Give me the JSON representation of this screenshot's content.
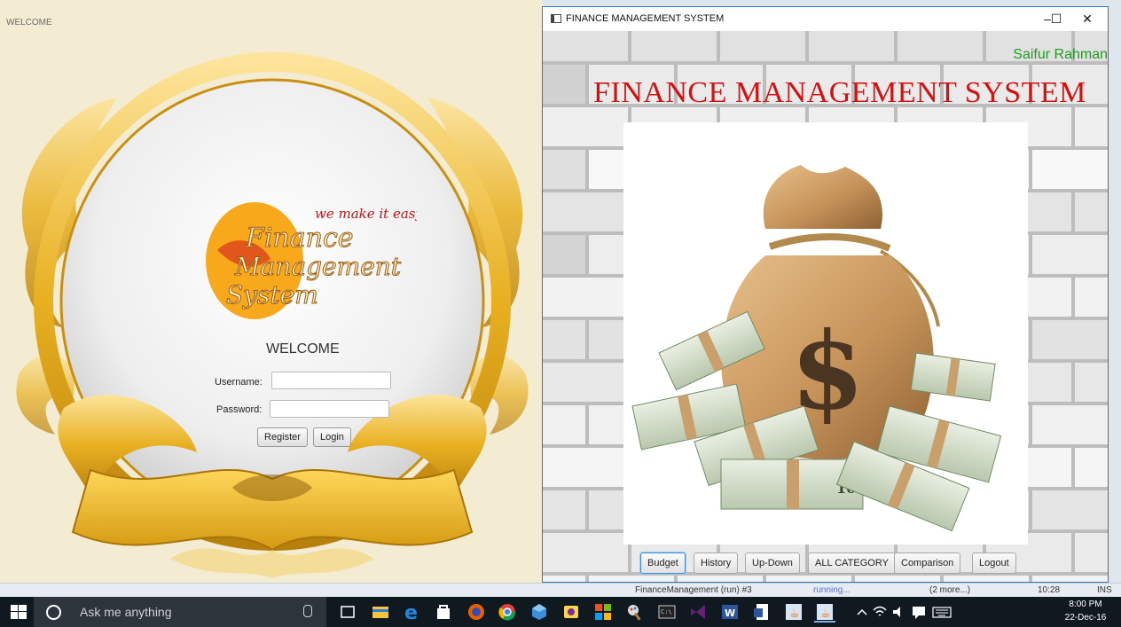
{
  "login": {
    "window_title": "WELCOME",
    "logo": {
      "tagline": "we make it easy",
      "line1": "Finance",
      "line2": "Management",
      "line3": "System"
    },
    "heading": "WELCOME",
    "username_label": "Username:",
    "username_value": "",
    "password_label": "Password:",
    "password_value": "",
    "register_label": "Register",
    "login_label": "Login"
  },
  "finance": {
    "window_title": "FINANCE MANAGEMENT SYSTEM",
    "controls": {
      "minimize": "–",
      "maximize": "☐",
      "close": "✕"
    },
    "author": "Saifur Rahman",
    "heading": "FINANCE MANAGEMENT SYSTEM",
    "buttons": [
      "Budget",
      "History",
      "Up-Down",
      "ALL CATEGORY",
      "Comparison",
      "Logout"
    ],
    "focused_button": "Budget",
    "bill_denomination": "100"
  },
  "ide_status": {
    "run_label": "FinanceManagement (run) #3",
    "status": "running...",
    "more": "(2 more...)",
    "position": "10:28",
    "mode": "INS"
  },
  "taskbar": {
    "search_placeholder": "Ask me anything",
    "time": "8:00 PM",
    "date": "22-Dec-16",
    "pinned_icons": [
      "task-view-icon",
      "file-explorer-icon",
      "edge-icon",
      "store-icon",
      "firefox-icon",
      "chrome-icon",
      "box-icon",
      "app-icon",
      "color-grid-icon",
      "paint-icon",
      "cmd-icon",
      "visual-studio-icon",
      "word-icon",
      "word-doc-icon",
      "java-icon",
      "java-active-icon"
    ],
    "tray_icons": [
      "chevron-up-icon",
      "wifi-icon",
      "volume-icon",
      "notification-icon",
      "keyboard-icon"
    ],
    "accent_color": "#7ab0e6"
  },
  "colors": {
    "heading_red": "#d41010",
    "author_green": "#1f9b1f",
    "gold": "#e8b020",
    "window_border": "#2b78c5"
  }
}
